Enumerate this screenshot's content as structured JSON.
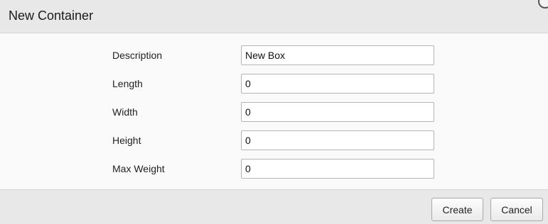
{
  "dialog": {
    "title": "New Container"
  },
  "form": {
    "fields": [
      {
        "label": "Description",
        "value": "New Box"
      },
      {
        "label": "Length",
        "value": "0"
      },
      {
        "label": "Width",
        "value": "0"
      },
      {
        "label": "Height",
        "value": "0"
      },
      {
        "label": "Max Weight",
        "value": "0"
      }
    ]
  },
  "footer": {
    "create_label": "Create",
    "cancel_label": "Cancel"
  }
}
